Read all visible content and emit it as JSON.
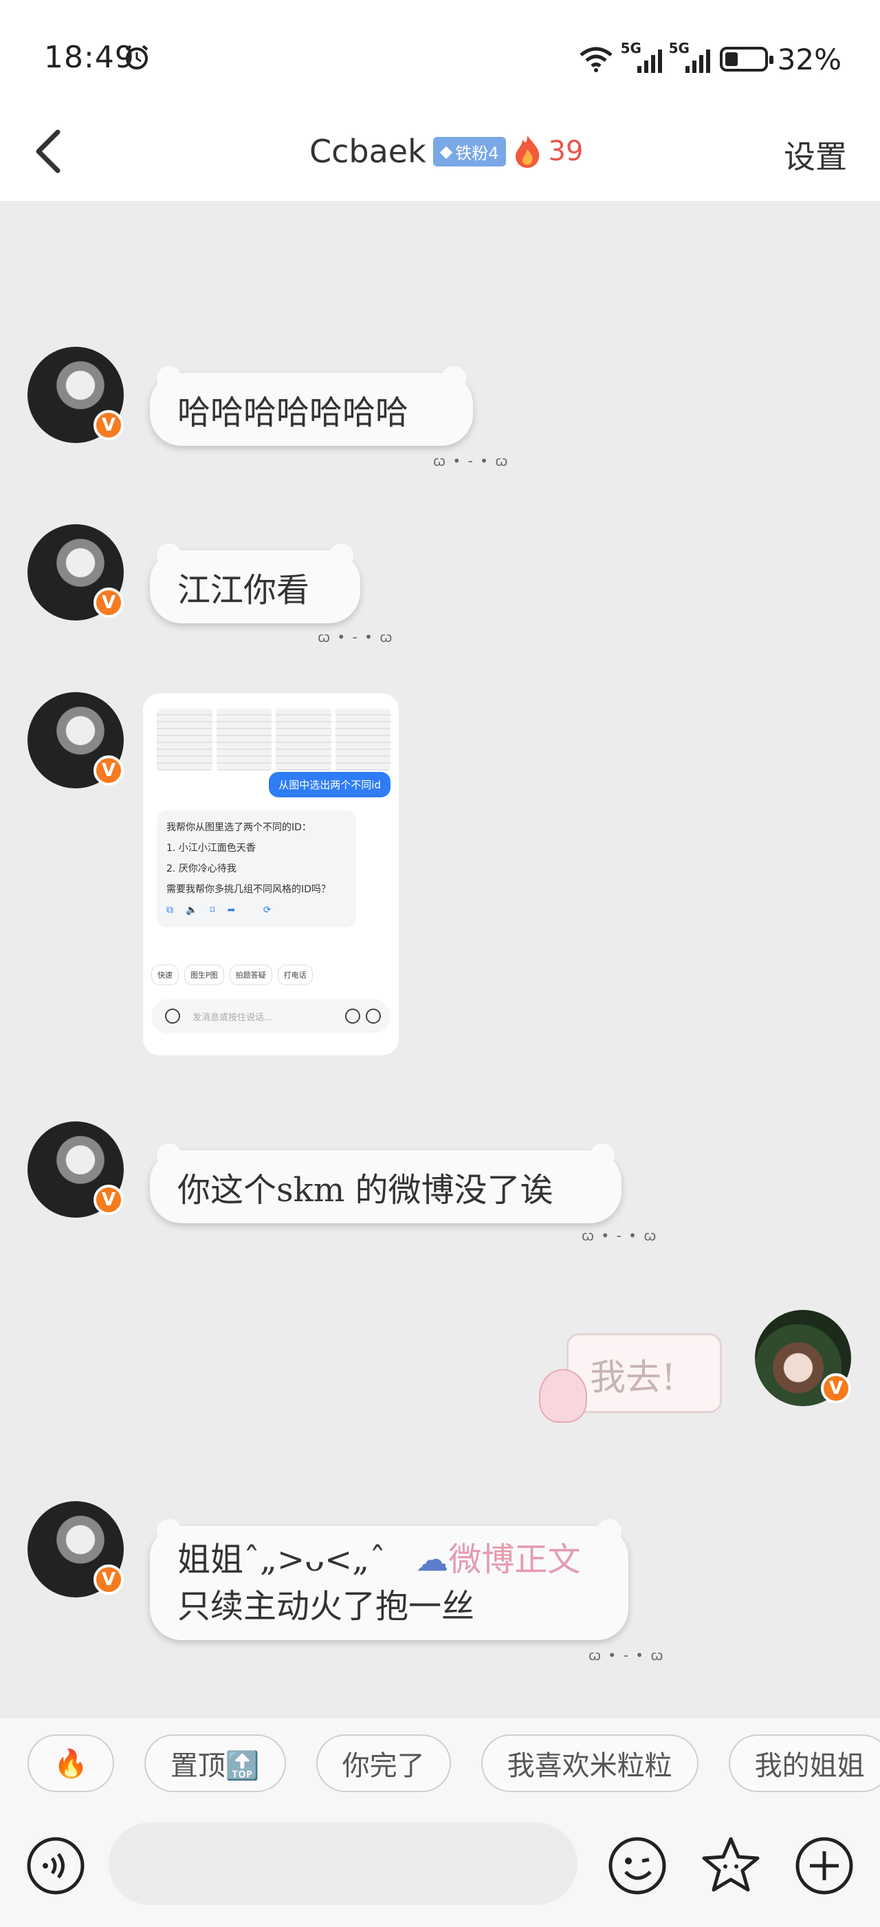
{
  "status_bar": {
    "time": "18:49",
    "net1": "5G",
    "net2": "5G",
    "battery": "32%"
  },
  "header": {
    "title": "Ccbaek",
    "badge": "铁粉4",
    "fire_count": "39",
    "settings": "设置"
  },
  "messages": {
    "m1": "哈哈哈哈哈哈哈",
    "m2": "江江你看",
    "m3_image": {
      "question": "从图中选出两个不同id",
      "answer_intro": "我帮你从图里选了两个不同的ID：",
      "answer_1": "1. 小江小江面色天香",
      "answer_2": "2. 厌你冷心待我",
      "answer_followup": "需要我帮你多挑几组不同风格的ID吗？",
      "chips": [
        "快速",
        "图生P图",
        "拍题答疑",
        "打电话"
      ],
      "input_placeholder": "发消息或按住说话..."
    },
    "m4": "你这个skm 的微博没了诶",
    "m5_sticker": "我去!",
    "m6_line1": "姐姐ˆ„>ᴗ<„ˆ",
    "m6_link": "微博正文",
    "m6_line2": "只续主动火了抱一丝"
  },
  "quick_replies": [
    "🔥",
    "置顶🔝",
    "你完了",
    "我喜欢米粒粒",
    "我的姐姐"
  ],
  "icons": {
    "back": "back-arrow-icon",
    "alarm": "alarm-icon",
    "fire": "fire-icon",
    "voice": "voice-icon",
    "emoji": "emoji-icon",
    "sticker": "sticker-icon",
    "plus": "plus-icon"
  },
  "colors": {
    "accent_fire": "#e8554a",
    "badge_blue": "#7aa8e6",
    "v_badge": "#f57b1f",
    "link_pink": "#e59bb0"
  }
}
